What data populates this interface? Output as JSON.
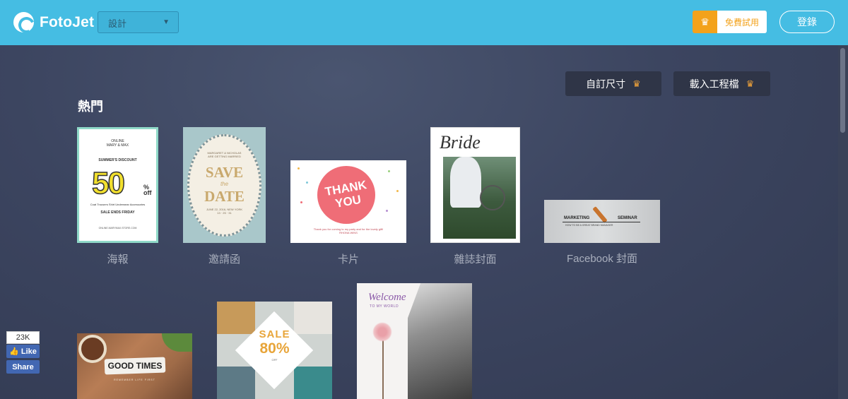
{
  "header": {
    "brand": "FotoJet",
    "design_select": {
      "value": "設計"
    },
    "trial_label": "免費試用",
    "login_label": "登錄"
  },
  "actions": {
    "custom_size_label": "自訂尺寸",
    "load_project_label": "載入工程檔"
  },
  "section_title": "熱門",
  "categories": [
    {
      "label": "海報",
      "thumb": {
        "t1": "ONLINE\nMARY & MAX",
        "t2": "SUMMER'S DISCOUNT",
        "big": "50",
        "pct": "%\noff",
        "t3": "Coat   Trousers   Shirt   Underwear   Accessories",
        "t4": "SALE ENDS FRIDAY",
        "t5": "ONLINE.MARYMAX.STORE.COM"
      }
    },
    {
      "label": "邀請函",
      "thumb": {
        "top": "MARGARET & NICHOLAS\nARE GETTING MARRIED",
        "save": "SAVE",
        "the": "the",
        "date": "DATE",
        "bottom": "JUNE 22, 2016, NEW YORK\n13 · 25 · 31"
      }
    },
    {
      "label": "卡片",
      "thumb": {
        "text": "THANK YOU",
        "note": "Thank you for coming to my party and for the lovely gift!\nRHONA WINS"
      }
    },
    {
      "label": "雜誌封面",
      "thumb": {
        "brand": "Bride"
      }
    },
    {
      "label": "Facebook 封面",
      "thumb": {
        "left": "MARKETING",
        "right": "SEMINAR",
        "sub": "HOW TO BE A GREAT BRAND MANAGER"
      }
    }
  ],
  "row2": [
    {
      "thumb": {
        "text": "GOOD TIMES",
        "sub": "REMEMBER LIFE FIRST"
      }
    },
    {
      "thumb": {
        "s1": "SALE",
        "s2": "80%",
        "off": "OFF"
      }
    },
    {
      "thumb": {
        "t1": "Welcome",
        "t2": "TO MY WORLD"
      }
    }
  ],
  "social": {
    "like_count": "23K",
    "like_label": "Like",
    "share_label": "Share"
  },
  "colors": {
    "header_bg": "#45bde3",
    "trial_accent": "#f3a21b",
    "page_bg": "#3c4560",
    "facebook_blue": "#4267b2"
  }
}
